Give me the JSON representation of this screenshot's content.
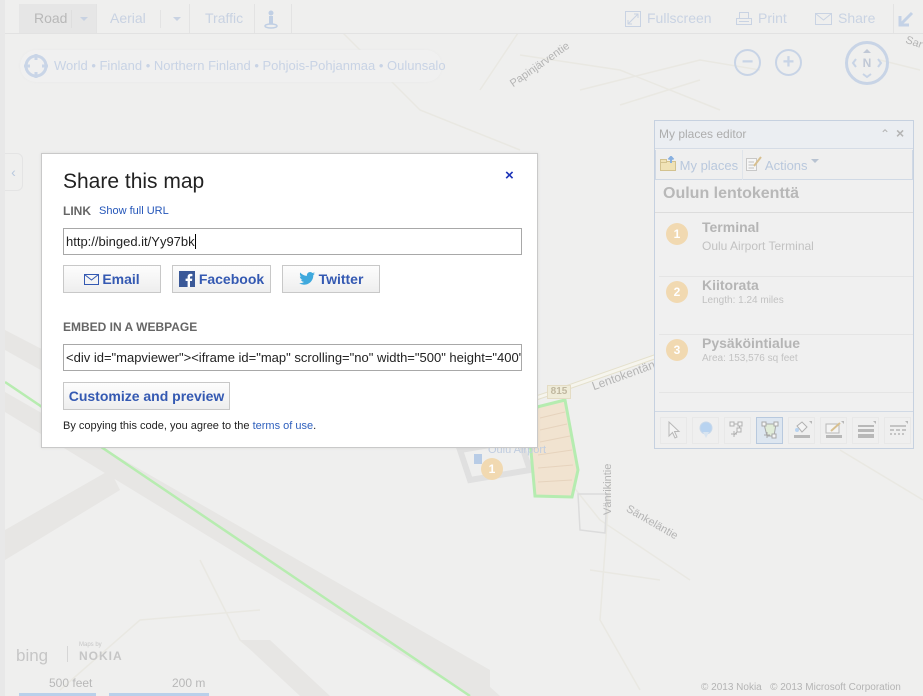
{
  "toolbar": {
    "road": "Road",
    "aerial": "Aerial",
    "traffic": "Traffic",
    "streetside_icon": "person-icon",
    "fullscreen": "Fullscreen",
    "print": "Print",
    "share": "Share",
    "collapse_icon": "arrow-down-left-icon"
  },
  "breadcrumb": {
    "icon": "locate-icon",
    "text": "World • Finland • Northern Finland • Pohjois-Pohjanmaa • Oulunsalo"
  },
  "map_controls": {
    "zoom_out": "−",
    "zoom_in": "+",
    "compass": "N"
  },
  "dialog": {
    "title": "Share this map",
    "close": "×",
    "link_label": "LINK",
    "show_full_url": "Show full URL",
    "link_value": "http://binged.it/Yy97bk",
    "email": "Email",
    "facebook": "Facebook",
    "twitter": "Twitter",
    "embed_label": "EMBED IN A WEBPAGE",
    "embed_value": "<div id=\"mapviewer\"><iframe id=\"map\" scrolling=\"no\" width=\"500\" height=\"400\"",
    "customize": "Customize and preview",
    "note_prefix": "By copying this code, you agree to the ",
    "note_link": "terms of use",
    "note_suffix": "."
  },
  "editor": {
    "title": "My places editor",
    "tabs": [
      "My places",
      "Actions"
    ],
    "collection_name": "Oulun lentokenttä",
    "items": [
      {
        "number": "1",
        "title": "Terminal",
        "subtitle": "Oulu Airport Terminal"
      },
      {
        "number": "2",
        "title": "Kiitorata",
        "subtitle": "Length: 1.24 miles"
      },
      {
        "number": "3",
        "title": "Pysäköintialue",
        "subtitle": "Area: 153,576 sq feet"
      }
    ],
    "tools": [
      "select-icon",
      "pushpin-icon",
      "polyline-icon",
      "polygon-icon",
      "fill-color-icon",
      "line-color-icon",
      "line-width-icon",
      "line-style-icon"
    ]
  },
  "map_labels": {
    "papinjarventie": "Papinjärventie",
    "lentokentantie": "Lentokentäntie",
    "route": "815",
    "oulu_airport": "Oulu Airport",
    "vanrikintie": "Vänrikintie",
    "sankelantie": "Sänkeläntie",
    "sar": "Sar",
    "airport_badge": "1"
  },
  "footer": {
    "bing": "bing",
    "maps_by": "Maps by",
    "nokia": "NOKIA",
    "scale_imperial": "500 feet",
    "scale_metric": "200 m",
    "copyright_nokia": "© 2013 Nokia",
    "copyright_ms": "© 2013 Microsoft Corporation"
  }
}
